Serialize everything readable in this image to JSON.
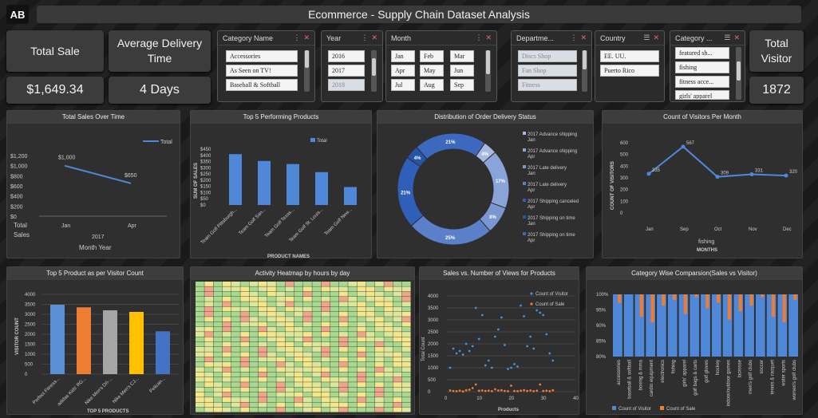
{
  "logo": "AB",
  "title": "Ecommerce - Supply Chain Dataset Analysis",
  "kpi": {
    "total_sale_label": "Total Sale",
    "total_sale_value": "$1,649.34",
    "avg_delivery_label": "Average Delivery Time",
    "avg_delivery_value": "4 Days",
    "total_visitor_label": "Total Visitor",
    "total_visitor_value": "1872"
  },
  "slicers": {
    "category": {
      "title": "Category Name",
      "items": [
        "Accessories",
        "As Seen on TV!",
        "Baseball & Softball"
      ]
    },
    "year": {
      "title": "Year",
      "items": [
        "2016",
        "2017",
        "2018"
      ]
    },
    "month": {
      "title": "Month",
      "items": [
        "Jan",
        "Feb",
        "Mar",
        "Apr",
        "May",
        "Jun",
        "Jul",
        "Aug",
        "Sep"
      ]
    },
    "department": {
      "title": "Departme...",
      "items": [
        "Discs Shop",
        "Fan Shop",
        "Fitness"
      ]
    },
    "country": {
      "title": "Country",
      "items": [
        "EE. UU.",
        "Puerto Rico"
      ]
    },
    "category2": {
      "title": "Category ...",
      "items": [
        "featured sh...",
        "fishing",
        "fitness acce...",
        "girls' apparel"
      ]
    }
  },
  "panels": {
    "sales_time": "Total Sales Over Time",
    "top5_products": "Top 5 Performing Products",
    "distribution": "Distribution of Order Delivery Status",
    "visitors_month": "Count of Visitors Per Month",
    "visitor_count": "Top 5 Product as per Visitor Count",
    "heatmap": "Activity Heatmap by hours by day",
    "sales_views": "Sales vs. Number of Views for Products",
    "category_compare": "Category Wise Comparsion(Sales vs Visitor)"
  },
  "chart_data": [
    {
      "type": "line",
      "title": "Total Sales Over Time",
      "legend": "Total",
      "x": [
        "Jan",
        "Apr"
      ],
      "values": [
        1000,
        650
      ],
      "data_labels": [
        "$1,000",
        "$650"
      ],
      "yticks": [
        "$1,200",
        "$1,000",
        "$800",
        "$600",
        "$400",
        "$200",
        "$0"
      ],
      "ylim": [
        0,
        1200
      ],
      "x_group": "2017",
      "xlabel": "Month Year",
      "ylabel_left": "Total Sales"
    },
    {
      "type": "bar",
      "title": "Top 5 Performing Products",
      "legend": "Total",
      "categories": [
        "Team Golf Pittsburgh...",
        "Team Golf San...",
        "Team Golf Texas...",
        "Team Golf St. Louis...",
        "Team Golf New..."
      ],
      "values": [
        410,
        355,
        330,
        265,
        145
      ],
      "yticks": [
        "$450",
        "$400",
        "$350",
        "$300",
        "$250",
        "$200",
        "$150",
        "$100",
        "$50",
        "$0"
      ],
      "ylim": [
        0,
        450
      ],
      "xlabel": "PRODUCT NAMES",
      "ylabel": "SUM OF SALES"
    },
    {
      "type": "pie",
      "title": "Distribution of Order Delivery Status",
      "slices": [
        {
          "label": "2017 Advance shipping Jan",
          "value": 4,
          "color": "#a9b8e0"
        },
        {
          "label": "2017 Advance shipping Apr",
          "value": 17,
          "color": "#8aa3d8"
        },
        {
          "label": "2017 Late delivery Jan",
          "value": 8,
          "color": "#7b97d2"
        },
        {
          "label": "2017 Late delivery Apr",
          "value": 25,
          "color": "#5b7fc8"
        },
        {
          "label": "2017 Shipping canceled Apr",
          "value": 21,
          "color": "#2f5fb8"
        },
        {
          "label": "2017 Shipping on time Jan",
          "value": 4,
          "color": "#2456a8"
        },
        {
          "label": "2017 Shipping on time Apr",
          "value": 21,
          "color": "#3c69bd"
        }
      ]
    },
    {
      "type": "line",
      "title": "Count of Visitors Per Month",
      "x": [
        "Jan",
        "Sep",
        "Oct",
        "Nov",
        "Dec"
      ],
      "values": [
        335,
        567,
        309,
        331,
        320
      ],
      "yticks": [
        "600",
        "500",
        "400",
        "300",
        "200",
        "100",
        "0"
      ],
      "ylim": [
        0,
        600
      ],
      "x_group": "fishing",
      "xlabel": "MONTHS",
      "ylabel": "COUNT OF VISITORS"
    },
    {
      "type": "bar",
      "title": "Top 5 Product as per Visitor Count",
      "categories": [
        "Perfect Fitness...",
        "adidas Kids' RG...",
        "Nike Men's Dri-...",
        "Nike Men's CJ...",
        "Pelican..."
      ],
      "values": [
        3480,
        3350,
        3200,
        3120,
        2150
      ],
      "colors": [
        "#5b8fd6",
        "#ed7d31",
        "#a5a5a5",
        "#ffc000",
        "#4472c4"
      ],
      "yticks": [
        "4000",
        "3500",
        "3000",
        "2500",
        "2000",
        "1500",
        "1000",
        "500",
        "0"
      ],
      "ylim": [
        0,
        4000
      ],
      "xlabel": "TOP 5 PRODUCTS",
      "ylabel": "VISITOR COUNT"
    },
    {
      "type": "scatter",
      "title": "Sales vs. Number of Views for Products",
      "series": [
        {
          "name": "Count of Visitor",
          "color": "#4a90d9",
          "points": [
            [
              1,
              1000
            ],
            [
              2,
              1800
            ],
            [
              3,
              1600
            ],
            [
              4,
              1700
            ],
            [
              5,
              1550
            ],
            [
              6,
              2000
            ],
            [
              7,
              1700
            ],
            [
              8,
              1900
            ],
            [
              9,
              3500
            ],
            [
              10,
              2200
            ],
            [
              11,
              3200
            ],
            [
              12,
              1100
            ],
            [
              13,
              1300
            ],
            [
              14,
              1000
            ],
            [
              15,
              2300
            ],
            [
              16,
              2600
            ],
            [
              17,
              3100
            ],
            [
              18,
              1950
            ],
            [
              19,
              950
            ],
            [
              20,
              1000
            ],
            [
              21,
              1150
            ],
            [
              22,
              1050
            ],
            [
              23,
              3600
            ],
            [
              24,
              3150
            ],
            [
              25,
              1900
            ],
            [
              26,
              2300
            ],
            [
              27,
              1800
            ],
            [
              28,
              3400
            ],
            [
              29,
              3300
            ],
            [
              30,
              3200
            ],
            [
              31,
              2400
            ],
            [
              32,
              1600
            ],
            [
              33,
              1300
            ]
          ]
        },
        {
          "name": "Count of Sale",
          "color": "#ed7d31",
          "points": [
            [
              1,
              50
            ],
            [
              2,
              30
            ],
            [
              3,
              20
            ],
            [
              4,
              40
            ],
            [
              5,
              10
            ],
            [
              6,
              60
            ],
            [
              7,
              80
            ],
            [
              8,
              150
            ],
            [
              9,
              300
            ],
            [
              10,
              40
            ],
            [
              11,
              50
            ],
            [
              12,
              30
            ],
            [
              13,
              40
            ],
            [
              14,
              20
            ],
            [
              15,
              100
            ],
            [
              16,
              50
            ],
            [
              17,
              60
            ],
            [
              18,
              30
            ],
            [
              19,
              20
            ],
            [
              20,
              250
            ],
            [
              21,
              30
            ],
            [
              22,
              20
            ],
            [
              23,
              40
            ],
            [
              24,
              60
            ],
            [
              25,
              30
            ],
            [
              26,
              50
            ],
            [
              27,
              20
            ],
            [
              28,
              40
            ],
            [
              29,
              300
            ],
            [
              30,
              30
            ],
            [
              31,
              40
            ],
            [
              32,
              20
            ],
            [
              33,
              60
            ]
          ]
        }
      ],
      "yticks": [
        "4000",
        "3500",
        "3000",
        "2500",
        "2000",
        "1500",
        "1000",
        "500",
        "0"
      ],
      "ylim": [
        0,
        4000
      ],
      "xticks": [
        "0",
        "10",
        "20",
        "30",
        "40"
      ],
      "xlim": [
        0,
        40
      ],
      "xlabel": "Products",
      "ylabel": "Total Count"
    },
    {
      "type": "bar",
      "title": "Category Wise Comparsion(Sales vs Visitor)",
      "categories": [
        "accessories",
        "baseball & softball",
        "boxing & mma",
        "cardio equipment",
        "electronics",
        "fishing",
        "girls' apparel",
        "golf bags & carts",
        "golf gloves",
        "hockey",
        "indoor/outdoor games",
        "lacrosse",
        "men's golf clubs",
        "soccer",
        "tennis & racquet",
        "water sports",
        "women's golf clubs"
      ],
      "visitor_share": [
        97,
        100,
        92,
        90,
        96,
        98,
        93,
        99,
        95,
        97,
        91,
        94,
        96,
        99,
        92,
        90,
        98
      ],
      "yticks": [
        "100%",
        "95%",
        "90%",
        "85%",
        "80%"
      ],
      "ylim": [
        80,
        100
      ],
      "legend": [
        "Count of Visitor",
        "Count of Sale"
      ]
    }
  ]
}
